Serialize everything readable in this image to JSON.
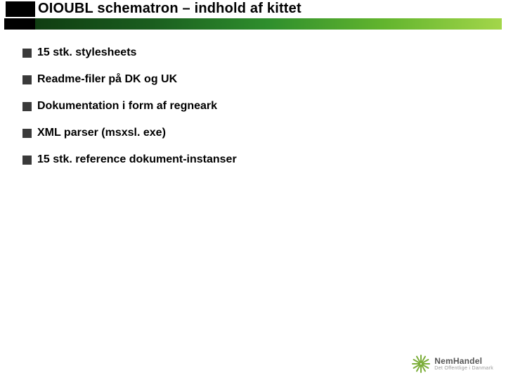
{
  "title": "OIOUBL schematron – indhold af kittet",
  "bullets": [
    "15 stk. stylesheets",
    "Readme-filer på DK og UK",
    "Dokumentation i form af regneark",
    "XML parser (msxsl. exe)",
    "15 stk. reference dokument-instanser"
  ],
  "logo": {
    "name": "NemHandel",
    "sub": "Det Offentlige i Danmark"
  }
}
